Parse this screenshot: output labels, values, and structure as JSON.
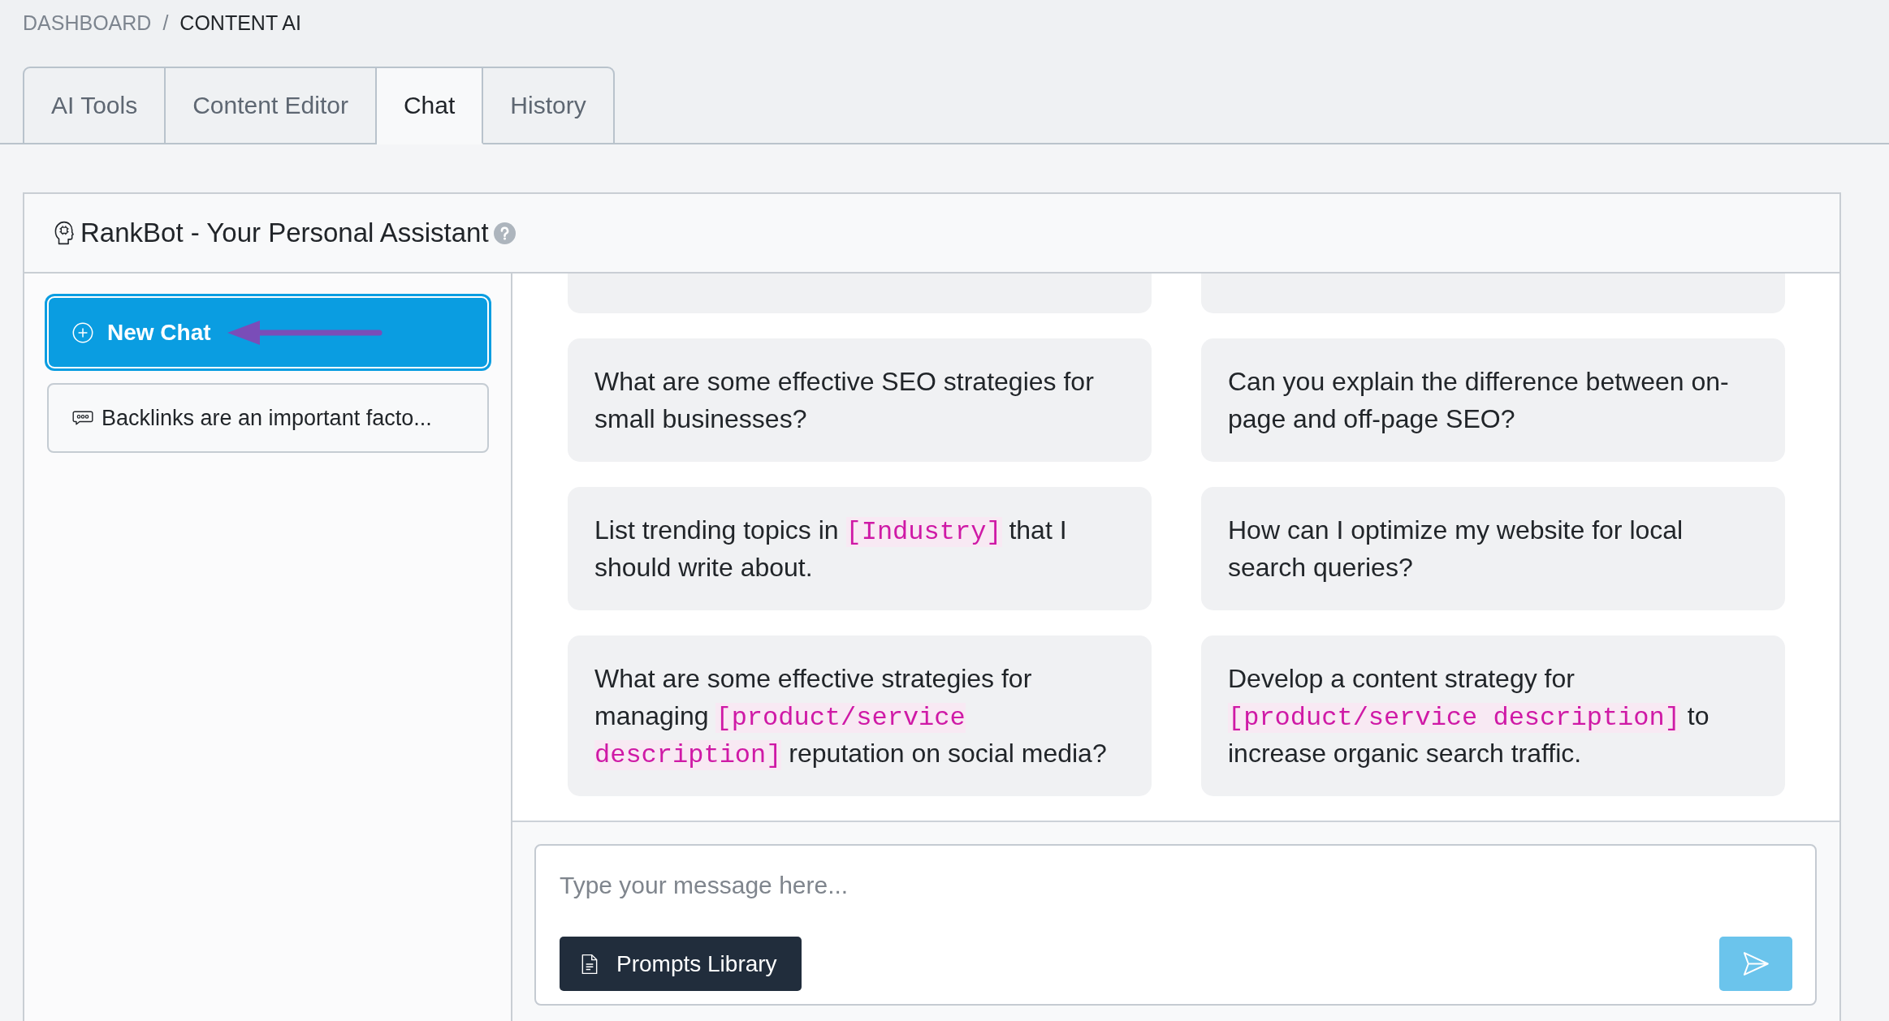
{
  "breadcrumb": {
    "separator": "/",
    "items": [
      {
        "label": "DASHBOARD",
        "current": false
      },
      {
        "label": "CONTENT AI",
        "current": true
      }
    ]
  },
  "tabs": [
    {
      "label": "AI Tools",
      "selected": false
    },
    {
      "label": "Content Editor",
      "selected": false
    },
    {
      "label": "Chat",
      "selected": true
    },
    {
      "label": "History",
      "selected": false
    }
  ],
  "panel": {
    "title": "RankBot - Your Personal Assistant"
  },
  "sidebar": {
    "new_chat_button": "New Chat",
    "conversations": [
      {
        "title": "Backlinks are an important facto..."
      }
    ]
  },
  "suggestions": [
    {
      "kind": "partial"
    },
    {
      "kind": "partial"
    },
    {
      "kind": "full",
      "parts": [
        {
          "kind": "text",
          "text": "What are some effective SEO strategies for small businesses?"
        }
      ]
    },
    {
      "kind": "full",
      "parts": [
        {
          "kind": "text",
          "text": "Can you explain the difference between on-page and off-page SEO?"
        }
      ]
    },
    {
      "kind": "full",
      "parts": [
        {
          "kind": "text",
          "text": "List trending topics in "
        },
        {
          "kind": "placeholder",
          "text": "[Industry]"
        },
        {
          "kind": "text",
          "text": " that I should write about."
        }
      ]
    },
    {
      "kind": "full",
      "parts": [
        {
          "kind": "text",
          "text": "How can I optimize my website for local search queries?"
        }
      ]
    },
    {
      "kind": "full",
      "parts": [
        {
          "kind": "text",
          "text": "What are some effective strategies for managing "
        },
        {
          "kind": "placeholder",
          "text": "[product/service description]"
        },
        {
          "kind": "text",
          "text": " reputation on social media?"
        }
      ]
    },
    {
      "kind": "full",
      "parts": [
        {
          "kind": "text",
          "text": "Develop a content strategy for "
        },
        {
          "kind": "placeholder",
          "text": "[product/service description]"
        },
        {
          "kind": "text",
          "text": " to increase organic search traffic."
        }
      ]
    }
  ],
  "composer": {
    "placeholder": "Type your message here...",
    "prompts_button": "Prompts Library",
    "send_button": {
      "disabled": true
    }
  }
}
